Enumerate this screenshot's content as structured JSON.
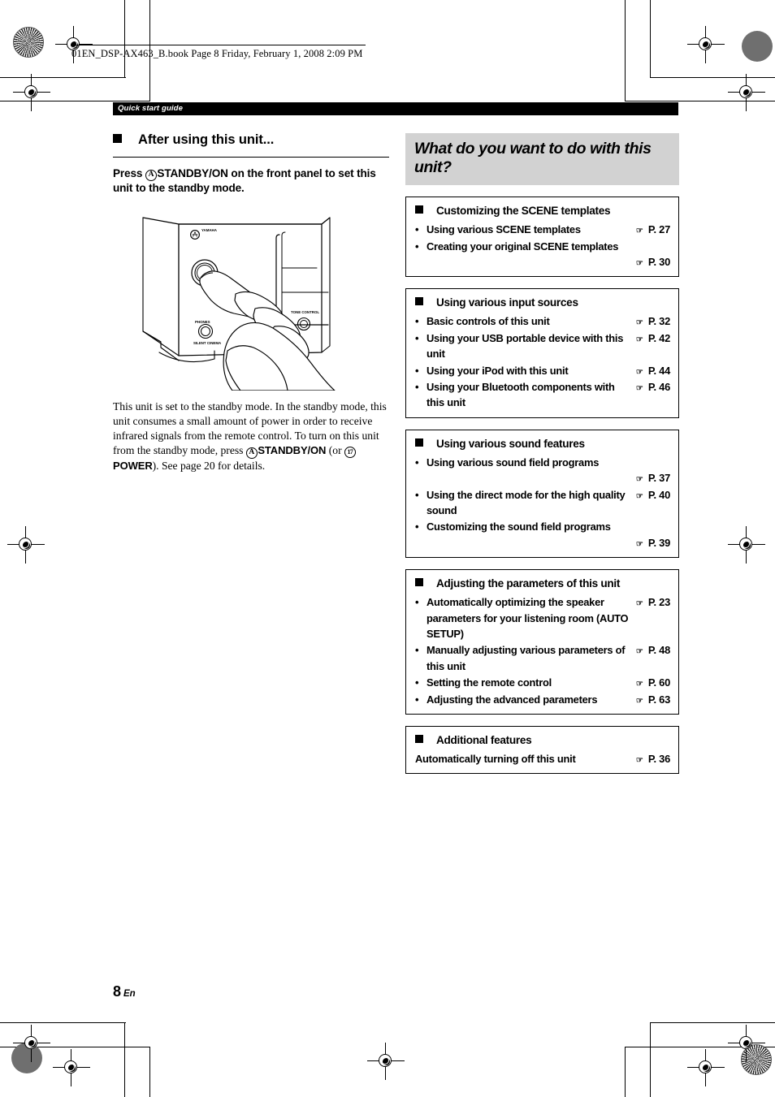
{
  "running_head": "01EN_DSP-AX463_B.book  Page 8  Friday, February 1, 2008  2:09 PM",
  "section_tab": "Quick start guide",
  "left": {
    "heading": "After using this unit...",
    "lead_prefix": "Press ",
    "lead_circled_a": "A",
    "lead_control": "STANDBY/ON",
    "lead_suffix": " on the front panel to set this unit to the standby mode.",
    "body_part1": "This unit is set to the standby mode. In the standby mode, this unit consumes a small amount of power in order to receive infrared signals from the remote control. To turn on this unit from the standby mode, press ",
    "body_circled_a": "A",
    "body_control1": "STANDBY/ON",
    "body_mid": " (or ",
    "body_circled_17": "17",
    "body_control2": "POWER",
    "body_part2": "). See page 20 for details.",
    "figure_brand": "YAMAHA",
    "figure_label_phones": "PHONES",
    "figure_label_silent": "SILENT CINEMA",
    "figure_label_tone": "TONE CONTROL"
  },
  "right": {
    "title": "What do you want to do with this unit?",
    "hand_icon": "☞",
    "boxes": [
      {
        "heading": "Customizing the SCENE templates",
        "items": [
          {
            "bullet": true,
            "text": "Using various SCENE templates",
            "ref": "P. 27",
            "ref_own_line": false
          },
          {
            "bullet": true,
            "text": "Creating your original SCENE templates",
            "ref": "P. 30",
            "ref_own_line": true
          }
        ]
      },
      {
        "heading": "Using various input sources",
        "items": [
          {
            "bullet": true,
            "text": "Basic controls of this unit",
            "ref": "P. 32",
            "ref_own_line": false
          },
          {
            "bullet": true,
            "text": "Using your USB portable device with this unit",
            "ref": "P. 42",
            "ref_own_line": false
          },
          {
            "bullet": true,
            "text": "Using your iPod with this unit",
            "ref": "P. 44",
            "ref_own_line": false
          },
          {
            "bullet": true,
            "text": "Using your Bluetooth components with this unit",
            "ref": "P. 46",
            "ref_own_line": false
          }
        ]
      },
      {
        "heading": "Using various sound features",
        "items": [
          {
            "bullet": true,
            "text": "Using various sound field programs",
            "ref": "P. 37",
            "ref_own_line": true
          },
          {
            "bullet": true,
            "text": "Using the direct mode for the high quality sound",
            "ref": "P. 40",
            "ref_own_line": false
          },
          {
            "bullet": true,
            "text": "Customizing the sound field programs",
            "ref": "P. 39",
            "ref_own_line": true
          }
        ]
      },
      {
        "heading": "Adjusting the parameters of this unit",
        "items": [
          {
            "bullet": true,
            "text": "Automatically optimizing the speaker parameters for your listening room (AUTO SETUP)",
            "ref": "P. 23",
            "ref_own_line": false
          },
          {
            "bullet": true,
            "text": "Manually adjusting various parameters of this unit",
            "ref": "P. 48",
            "ref_own_line": false
          },
          {
            "bullet": true,
            "text": "Setting the remote control",
            "ref": "P. 60",
            "ref_own_line": false
          },
          {
            "bullet": true,
            "text": "Adjusting the advanced parameters",
            "ref": "P. 63",
            "ref_own_line": false
          }
        ]
      },
      {
        "heading": "Additional features",
        "items": [
          {
            "bullet": false,
            "text": "Automatically turning off this unit",
            "ref": "P. 36",
            "ref_own_line": false
          }
        ]
      }
    ]
  },
  "footer": {
    "page_number": "8",
    "language": "En"
  }
}
